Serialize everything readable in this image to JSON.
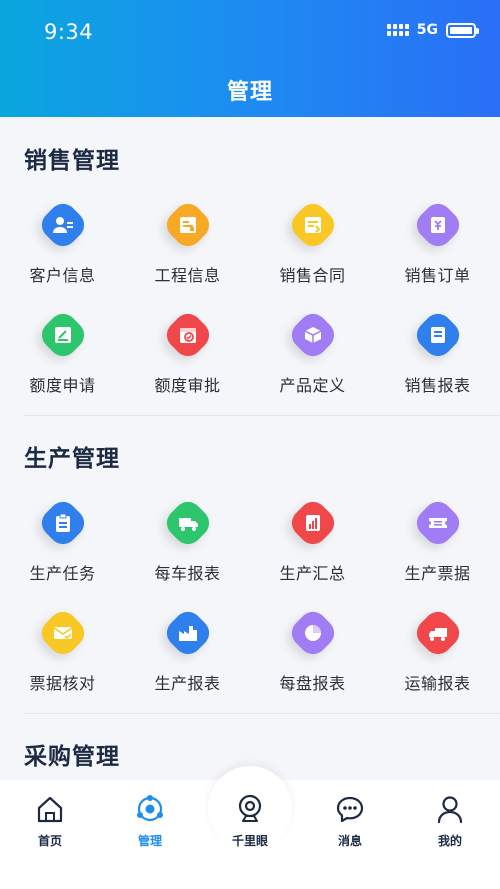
{
  "status": {
    "time": "9:34",
    "network": "5G"
  },
  "header": {
    "title": "管理"
  },
  "sections": [
    {
      "title": "销售管理",
      "items": [
        {
          "label": "客户信息",
          "icon": "customer-icon",
          "color": "#2f80ed"
        },
        {
          "label": "工程信息",
          "icon": "project-icon",
          "color": "#f7a825"
        },
        {
          "label": "销售合同",
          "icon": "contract-icon",
          "color": "#f9c824"
        },
        {
          "label": "销售订单",
          "icon": "order-icon",
          "color": "#a07cf5"
        },
        {
          "label": "额度申请",
          "icon": "quota-apply-icon",
          "color": "#2ec66d"
        },
        {
          "label": "额度审批",
          "icon": "quota-approve-icon",
          "color": "#f0474a"
        },
        {
          "label": "产品定义",
          "icon": "product-box-icon",
          "color": "#a07cf5"
        },
        {
          "label": "销售报表",
          "icon": "sales-report-icon",
          "color": "#2f80ed"
        }
      ]
    },
    {
      "title": "生产管理",
      "items": [
        {
          "label": "生产任务",
          "icon": "task-clipboard-icon",
          "color": "#2f80ed"
        },
        {
          "label": "每车报表",
          "icon": "truck-icon",
          "color": "#2ec66d"
        },
        {
          "label": "生产汇总",
          "icon": "summary-chart-icon",
          "color": "#f0474a"
        },
        {
          "label": "生产票据",
          "icon": "ticket-icon",
          "color": "#a07cf5"
        },
        {
          "label": "票据核对",
          "icon": "mail-check-icon",
          "color": "#f9c824"
        },
        {
          "label": "生产报表",
          "icon": "factory-icon",
          "color": "#2f80ed"
        },
        {
          "label": "每盘报表",
          "icon": "pie-chart-icon",
          "color": "#a07cf5"
        },
        {
          "label": "运输报表",
          "icon": "transport-truck-icon",
          "color": "#f0474a"
        }
      ]
    },
    {
      "title": "采购管理",
      "items": []
    }
  ],
  "bottom_nav": [
    {
      "label": "首页",
      "icon": "home-icon"
    },
    {
      "label": "管理",
      "icon": "manage-icon",
      "active": true
    },
    {
      "label": "千里眼",
      "icon": "camera-icon"
    },
    {
      "label": "消息",
      "icon": "message-icon"
    },
    {
      "label": "我的",
      "icon": "profile-icon"
    }
  ],
  "colors": {
    "accent": "#1c8ef0",
    "header_start": "#0aa6de",
    "header_end": "#2a6ff7"
  }
}
